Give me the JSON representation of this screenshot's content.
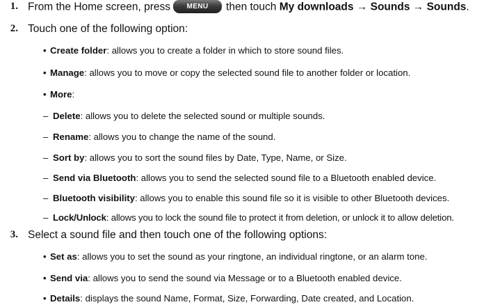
{
  "steps": [
    {
      "num": "1.",
      "text_before": "From the Home screen, press",
      "menu_button": "MENU",
      "text_mid": "then touch",
      "path": "My downloads → Sounds → Sounds",
      "text_end": "."
    },
    {
      "num": "2.",
      "text": "Touch one of the following option:"
    },
    {
      "num": "3.",
      "text": "Select a sound file and then touch one of the following options:"
    }
  ],
  "step2_items": [
    {
      "label": "Create folder",
      "sep": ":",
      "text": " allows you to create a folder in which to store sound files."
    },
    {
      "label": "Manage",
      "sep": ":",
      "text": " allows you to move or copy the selected sound file to another folder or location."
    },
    {
      "label": "More",
      "sep": ":",
      "text": ""
    }
  ],
  "more_items": [
    {
      "label": "Delete",
      "text": ": allows you to delete the selected sound or multiple sounds."
    },
    {
      "label": "Rename",
      "text": ": allows you to change the name of the sound."
    },
    {
      "label": "Sort by",
      "text": ": allows you to sort the sound files by Date, Type, Name, or Size."
    },
    {
      "label": "Send via Bluetooth",
      "text": ": allows you to send the selected sound file to a Bluetooth enabled device."
    },
    {
      "label": "Bluetooth visibility",
      "text": ": allows you to enable this sound file so it is visible to other Bluetooth devices."
    },
    {
      "label": "Lock/Unlock",
      "text": ": allows you to lock the sound file to protect it from deletion, or unlock it to allow deletion."
    }
  ],
  "step3_items": [
    {
      "label": "Set as",
      "text": ": allows you to set the sound as your ringtone, an individual ringtone, or an alarm tone."
    },
    {
      "label": "Send via",
      "text": ": allows you to send the sound via Message or to a Bluetooth enabled device."
    },
    {
      "label": "Details",
      "text": ": displays the sound Name, Format, Size, Forwarding, Date created, and Location."
    }
  ],
  "glyphs": {
    "bullet": "•",
    "dash": "–"
  }
}
